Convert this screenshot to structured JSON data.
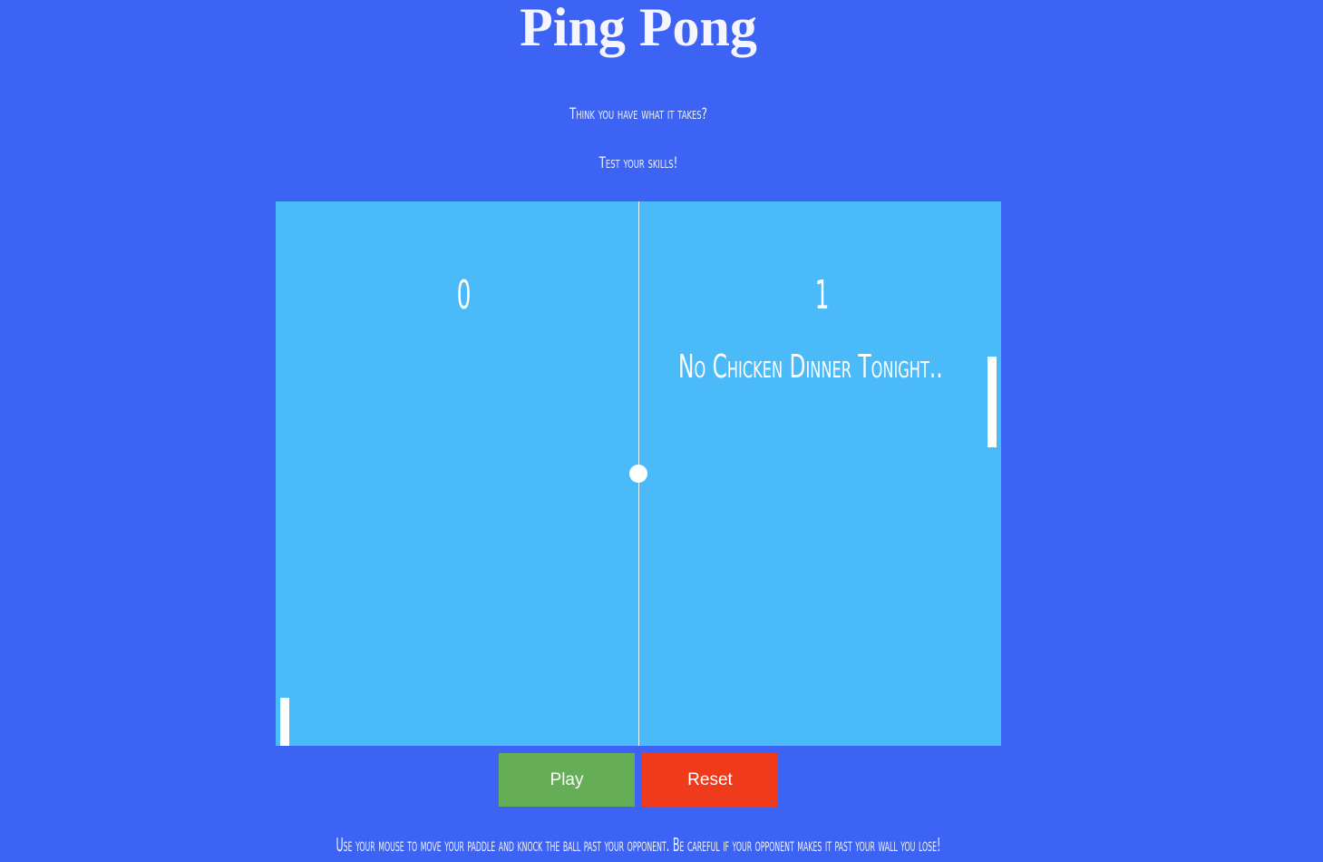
{
  "header": {
    "title": "Ping Pong",
    "tagline_1": "Think you have what it takes?",
    "tagline_2": "Test your skills!"
  },
  "game": {
    "score_left": "0",
    "score_right": "1",
    "message": "No Chicken Dinner Tonight.."
  },
  "controls": {
    "play_label": "Play",
    "reset_label": "Reset"
  },
  "footer": {
    "instructions": "Use your mouse to move your paddle and knock the ball past your opponent. Be careful if your opponent makes it past your wall you lose!"
  },
  "colors": {
    "page_background": "#3c63f3",
    "court": "#4bbaf9",
    "play_button": "#65ad56",
    "reset_button": "#ef3a1c"
  }
}
